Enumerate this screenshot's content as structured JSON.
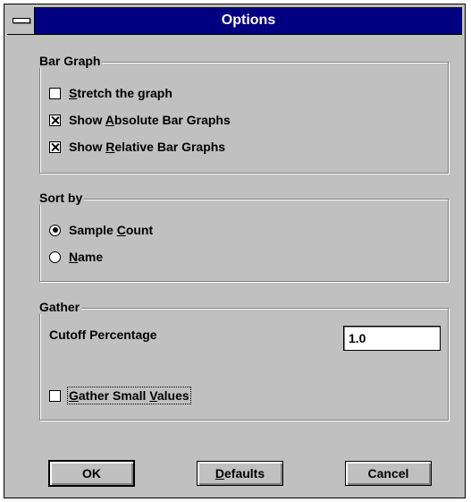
{
  "window": {
    "title": "Options"
  },
  "bar_graph": {
    "label": "Bar Graph",
    "items": [
      {
        "pre": "",
        "key": "S",
        "post": "tretch the graph",
        "checked": false
      },
      {
        "pre": "Show ",
        "key": "A",
        "post": "bsolute Bar Graphs",
        "checked": true
      },
      {
        "pre": "Show ",
        "key": "R",
        "post": "elative Bar Graphs",
        "checked": true
      }
    ]
  },
  "sort_by": {
    "label": "Sort by",
    "options": [
      {
        "pre": "Sample ",
        "key": "C",
        "post": "ount",
        "selected": true
      },
      {
        "pre": "",
        "key": "N",
        "post": "ame",
        "selected": false
      }
    ]
  },
  "gather": {
    "label": "Gather",
    "cutoff_label": "Cutoff Percentage",
    "cutoff_value": "1.0",
    "small_values": {
      "pre": "",
      "key": "G",
      "mid": "ather Small ",
      "key2": "V",
      "post": "alues",
      "checked": false
    }
  },
  "buttons": {
    "ok": "OK",
    "defaults_key": "D",
    "defaults_rest": "efaults",
    "cancel": "Cancel"
  }
}
